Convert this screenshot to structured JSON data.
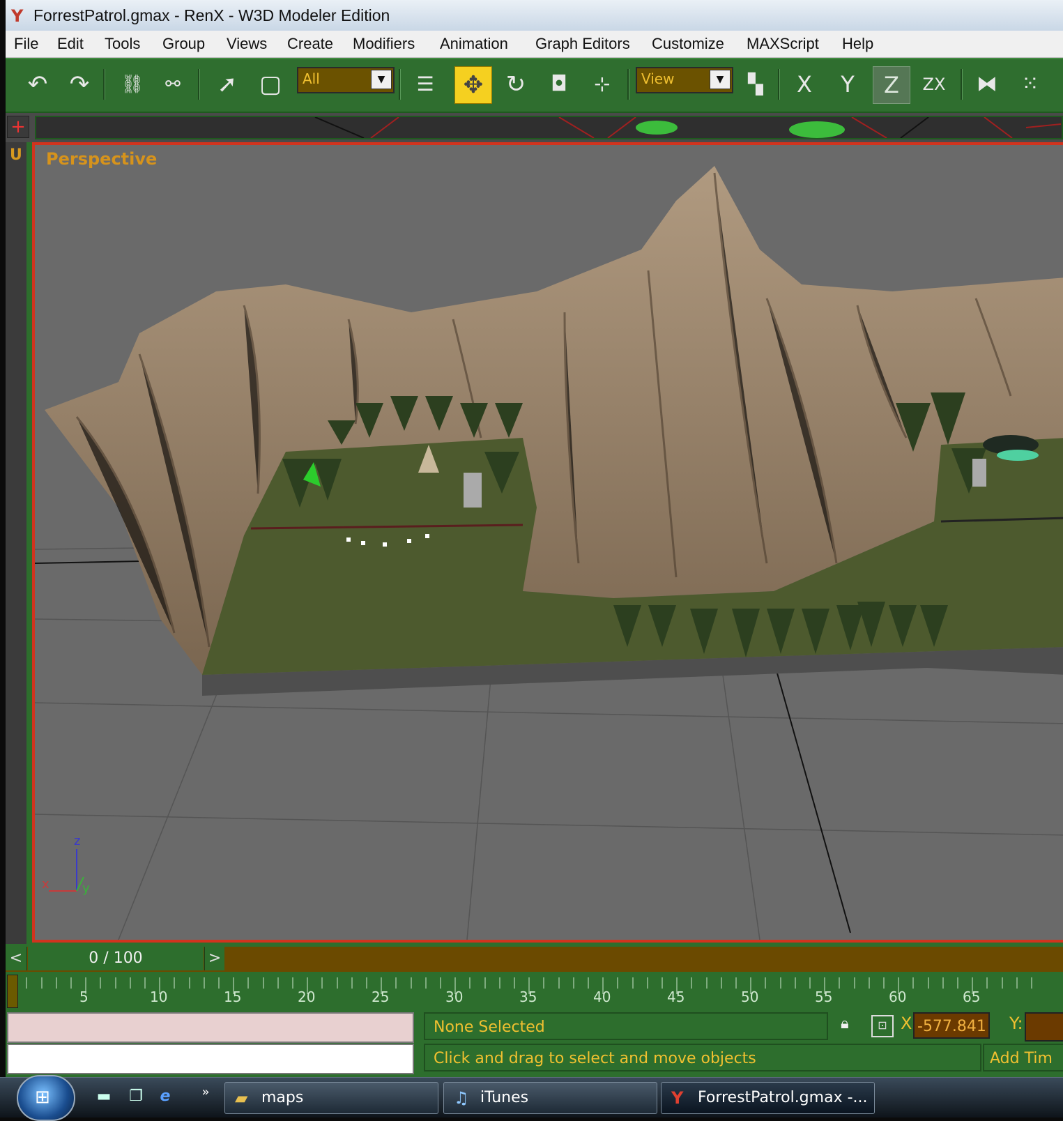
{
  "window": {
    "title": "ForrestPatrol.gmax - RenX - W3D Modeler Edition"
  },
  "menu": [
    "File",
    "Edit",
    "Tools",
    "Group",
    "Views",
    "Create",
    "Modifiers",
    "Animation",
    "Graph Editors",
    "Customize",
    "MAXScript",
    "Help"
  ],
  "toolbar": {
    "selection_filter": "All",
    "coord_system": "View",
    "axis_x": "X",
    "axis_y": "Y",
    "axis_z": "Z",
    "axis_zx": "ZX"
  },
  "viewport": {
    "left_label": "U",
    "label": "Perspective",
    "axis_labels": {
      "x": "x",
      "y": "y",
      "z": "z"
    }
  },
  "timeline": {
    "frame": "0 / 100",
    "prev": "<",
    "next": ">",
    "ticks": [
      "5",
      "10",
      "15",
      "20",
      "25",
      "30",
      "35",
      "40",
      "45",
      "50",
      "55",
      "60",
      "65"
    ]
  },
  "status": {
    "selection": "None Selected",
    "prompt": "Click and drag to select and move objects",
    "x_label": "X:",
    "x_value": "-577.841",
    "y_label": "Y:",
    "add_time_tag": "Add Tim"
  },
  "taskbar": {
    "chevron": "»",
    "tasks": [
      {
        "label": "maps"
      },
      {
        "label": "iTunes"
      },
      {
        "label": "ForrestPatrol.gmax -..."
      }
    ]
  },
  "colors": {
    "ui_green": "#2d6e2d",
    "viewport_border": "#d2331e",
    "label_orange": "#d6931c",
    "status_text": "#f0c030"
  }
}
